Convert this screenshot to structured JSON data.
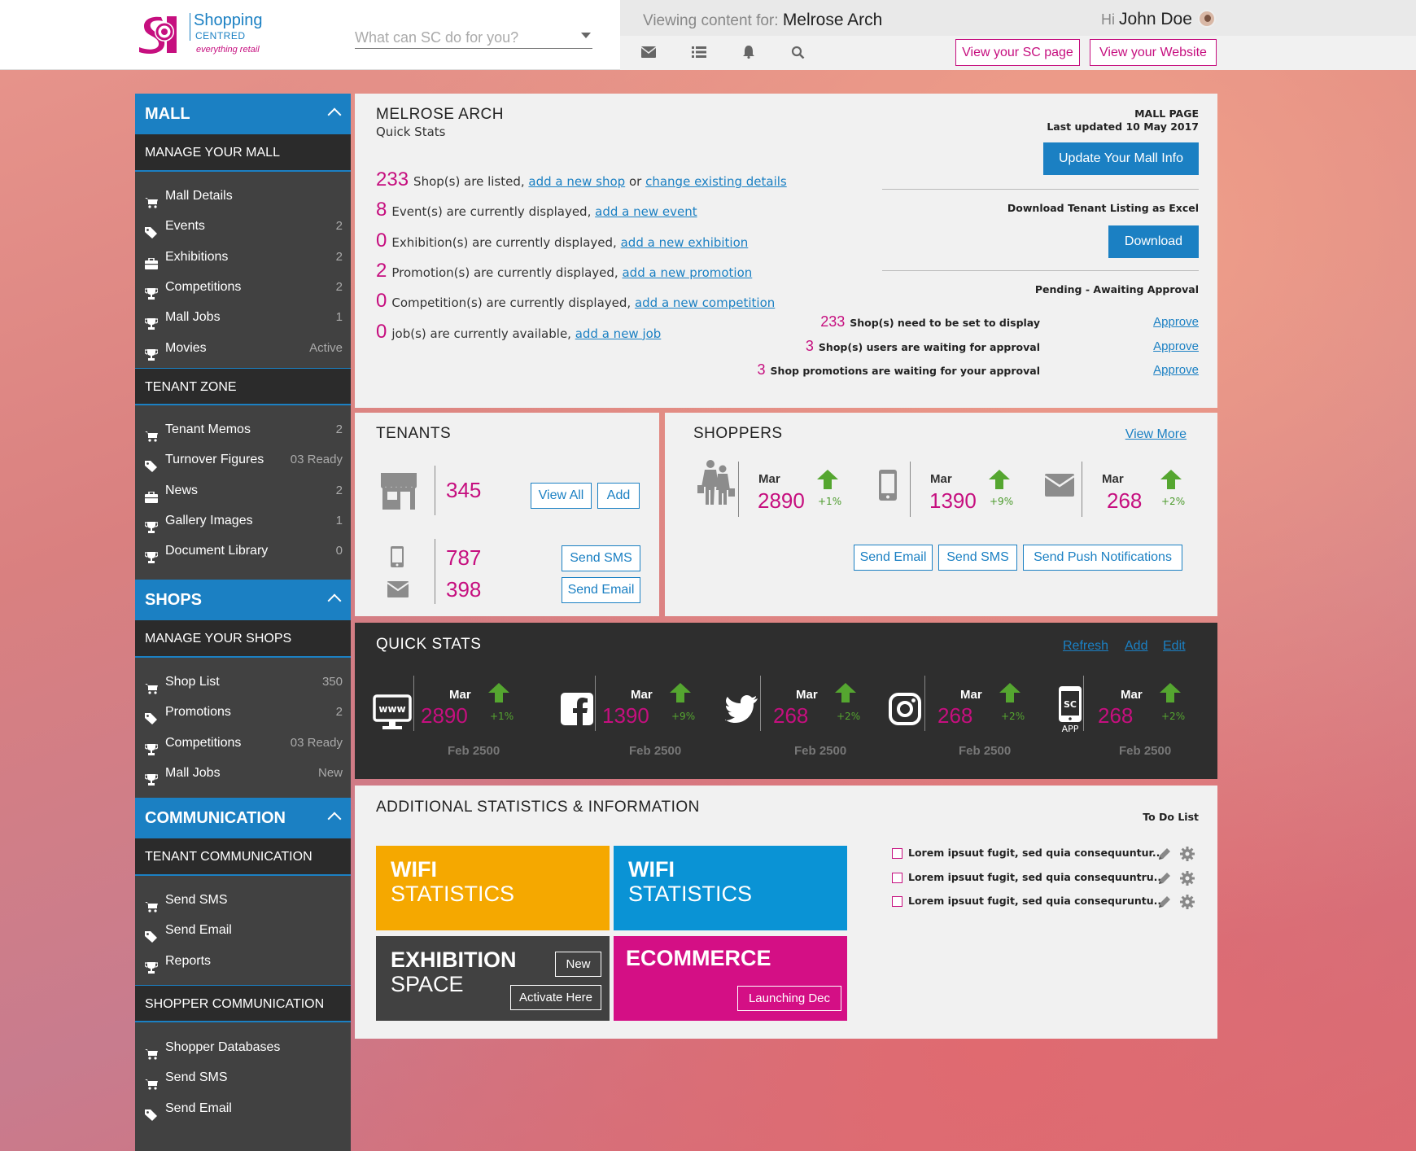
{
  "header": {
    "logo": {
      "name": "Shopping",
      "sub": "CENTRED",
      "tagline": "everything retail"
    },
    "search_placeholder": "What can SC do for you?",
    "viewing_label": "Viewing content for:",
    "viewing_value": "Melrose Arch",
    "greeting": "Hi",
    "user_name": "John Doe",
    "icons": [
      "envelope-icon",
      "list-icon",
      "bell-icon",
      "search-icon"
    ],
    "btn_sc_page": "View your SC page",
    "btn_website": "View your Website"
  },
  "sidebar": {
    "mall": {
      "title": "MALL",
      "sub": "MANAGE YOUR MALL",
      "items": [
        {
          "icon": "cart-icon",
          "label": "Mall Details",
          "count": ""
        },
        {
          "icon": "tag-icon",
          "label": "Events",
          "count": "2"
        },
        {
          "icon": "briefcase-icon",
          "label": "Exhibitions",
          "count": "2"
        },
        {
          "icon": "trophy-icon",
          "label": "Competitions",
          "count": "2"
        },
        {
          "icon": "trophy-icon",
          "label": "Mall Jobs",
          "count": "1"
        },
        {
          "icon": "trophy-icon",
          "label": "Movies",
          "count": "Active"
        }
      ],
      "sub2": "TENANT ZONE",
      "items2": [
        {
          "icon": "cart-icon",
          "label": "Tenant Memos",
          "count": "2"
        },
        {
          "icon": "tag-icon",
          "label": "Turnover Figures",
          "count": "03 Ready"
        },
        {
          "icon": "briefcase-icon",
          "label": "News",
          "count": "2"
        },
        {
          "icon": "trophy-icon",
          "label": "Gallery Images",
          "count": "1"
        },
        {
          "icon": "trophy-icon",
          "label": "Document Library",
          "count": "0"
        }
      ]
    },
    "shops": {
      "title": "SHOPS",
      "sub": "MANAGE YOUR SHOPS",
      "items": [
        {
          "icon": "cart-icon",
          "label": "Shop List",
          "count": "350"
        },
        {
          "icon": "tag-icon",
          "label": "Promotions",
          "count": "2"
        },
        {
          "icon": "trophy-icon",
          "label": "Competitions",
          "count": "03 Ready"
        },
        {
          "icon": "trophy-icon",
          "label": "Mall Jobs",
          "count": "New"
        }
      ]
    },
    "communication": {
      "title": "COMMUNICATION",
      "sub": "TENANT COMMUNICATION",
      "items": [
        {
          "icon": "cart-icon",
          "label": "Send SMS"
        },
        {
          "icon": "tag-icon",
          "label": "Send Email"
        },
        {
          "icon": "trophy-icon",
          "label": "Reports"
        }
      ],
      "sub2": "SHOPPER COMMUNICATION",
      "items2": [
        {
          "icon": "cart-icon",
          "label": "Shopper Databases"
        },
        {
          "icon": "cart-icon",
          "label": "Send SMS"
        },
        {
          "icon": "tag-icon",
          "label": "Send Email"
        }
      ]
    }
  },
  "mall_panel": {
    "title": "MELROSE ARCH",
    "subtitle": "Quick Stats",
    "lines": [
      {
        "num": "233",
        "text": "Shop(s) are listed,",
        "link1": "add a new shop",
        "mid": "or",
        "link2": "change existing details"
      },
      {
        "num": "8",
        "text": "Event(s) are currently displayed,",
        "link1": "add a new event"
      },
      {
        "num": "0",
        "text": "Exhibition(s) are currently displayed,",
        "link1": "add a new exhibition"
      },
      {
        "num": "2",
        "text": "Promotion(s) are currently displayed,",
        "link1": "add a new promotion"
      },
      {
        "num": "0",
        "text": "Competition(s) are currently displayed,",
        "link1": "add a new competition"
      },
      {
        "num": "0",
        "text": "job(s) are currently available,",
        "link1": "add a new job"
      }
    ],
    "page_label": "MALL PAGE",
    "last_updated": "Last updated 10 May 2017",
    "update_btn": "Update Your Mall Info",
    "download_label": "Download Tenant Listing as Excel",
    "download_btn": "Download",
    "pending_label": "Pending - Awaiting Approval",
    "pending": [
      {
        "num": "233",
        "text": "Shop(s) need to be set to display",
        "link": "Approve"
      },
      {
        "num": "3",
        "text": "Shop(s) users are waiting for approval",
        "link": "Approve"
      },
      {
        "num": "3",
        "text": "Shop promotions are waiting for your approval",
        "link": "Approve"
      }
    ]
  },
  "tenants": {
    "title": "TENANTS",
    "count": "345",
    "view_all": "View All",
    "add": "Add",
    "sms_count": "787",
    "email_count": "398",
    "send_sms": "Send SMS",
    "send_email": "Send Email"
  },
  "shoppers": {
    "title": "SHOPPERS",
    "view_more": "View More",
    "stats": [
      {
        "icon": "shoppers-icon",
        "month": "Mar",
        "value": "2890",
        "pct": "+1%"
      },
      {
        "icon": "mobile-icon",
        "month": "Mar",
        "value": "1390",
        "pct": "+9%"
      },
      {
        "icon": "envelope-icon",
        "month": "Mar",
        "value": "268",
        "pct": "+2%"
      }
    ],
    "send_email": "Send Email",
    "send_sms": "Send SMS",
    "send_push": "Send Push Notifications"
  },
  "quick_stats": {
    "title": "QUICK STATS",
    "refresh": "Refresh",
    "add": "Add",
    "edit": "Edit",
    "items": [
      {
        "icon": "www-icon",
        "icon_text": "www",
        "month": "Mar",
        "value": "2890",
        "pct": "+1%",
        "prev": "Feb 2500"
      },
      {
        "icon": "facebook-icon",
        "icon_text": "",
        "month": "Mar",
        "value": "1390",
        "pct": "+9%",
        "prev": "Feb 2500"
      },
      {
        "icon": "twitter-icon",
        "icon_text": "",
        "month": "Mar",
        "value": "268",
        "pct": "+2%",
        "prev": "Feb 2500"
      },
      {
        "icon": "instagram-icon",
        "icon_text": "",
        "month": "Mar",
        "value": "268",
        "pct": "+2%",
        "prev": "Feb 2500"
      },
      {
        "icon": "app-icon",
        "icon_text": "SC",
        "icon_sub": "APP",
        "month": "Mar",
        "value": "268",
        "pct": "+2%",
        "prev": "Feb 2500"
      }
    ]
  },
  "additional": {
    "title": "ADDITIONAL STATISTICS & INFORMATION",
    "tiles": [
      {
        "t1": "WIFI",
        "t2": "STATISTICS",
        "color": "#f5a800"
      },
      {
        "t1": "WIFI",
        "t2": "STATISTICS",
        "color": "#0a93d5"
      },
      {
        "t1": "EXHIBITION",
        "t2": "SPACE",
        "btn1": "New",
        "btn2": "Activate Here",
        "color": "#414141"
      },
      {
        "t1": "ECOMMERCE",
        "btn1": "Launching Dec",
        "color": "#d40f85"
      }
    ],
    "todo_title": "To Do List",
    "todo": [
      "Lorem ipsuut fugit, sed quia consequuntur...",
      "Lorem ipsuut fugit, sed quia consequuntru...",
      "Lorem ipsuut fugit, sed quia consequruntu..."
    ]
  },
  "colors": {
    "accent_blue": "#1b80c3",
    "accent_pink": "#c60f7f",
    "trend_green": "#55a630",
    "sidebar_bg": "#414141",
    "dark_panel": "#2e2e2e"
  }
}
